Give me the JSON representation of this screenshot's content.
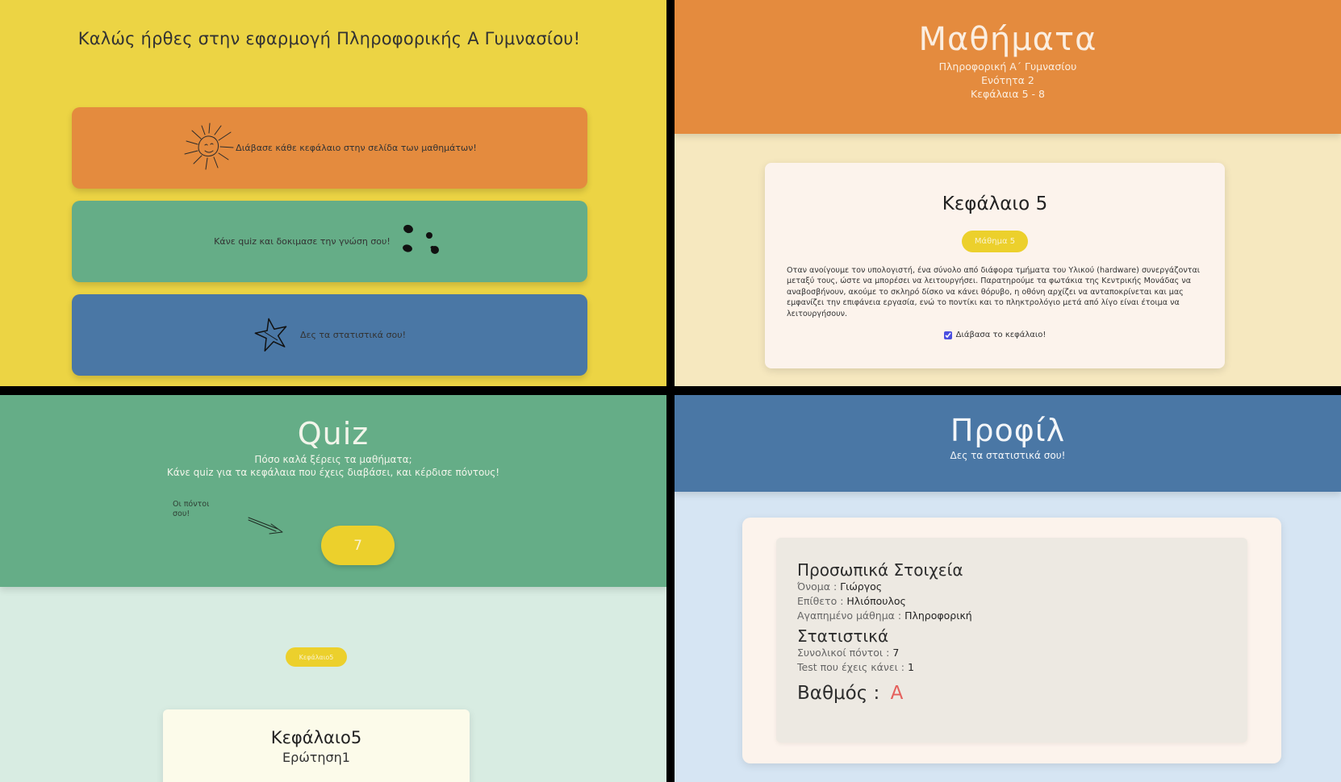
{
  "home": {
    "title": "Καλώς ήρθες στην εφαρμογή Πληροφορικής Α Γυμνασίου!",
    "cards": [
      {
        "label": "Διάβασε κάθε κεφάλαιο στην σελίδα των μαθημάτων!",
        "icon": "sun-doodle-icon",
        "color": "#e48b3e"
      },
      {
        "label": "Κάνε quiz και δοκιμασε την γνώση σου!",
        "icon": "dots-doodle-icon",
        "color": "#65ad87"
      },
      {
        "label": "Δες τα στατιστικά σου!",
        "icon": "star-doodle-icon",
        "color": "#4a77a5"
      }
    ]
  },
  "lessons": {
    "title": "Μαθήματα",
    "subtitle_lines": [
      "Πληροφορική Α΄ Γυμνασίου",
      "Ενότητα 2",
      "Κεφάλαια 5 - 8"
    ],
    "chapter": {
      "title": "Κεφάλαιο 5",
      "button_label": "Μάθημα 5",
      "text": "Οταν ανοίγουμε τον υπολογιστή, ένα σύνολο από διάφορα τμήματα του Υλικού (hardware) συνεργάζονται μεταξύ τους, ώστε να μπορέσει να λειτουργήσει. Παρατηρούμε τα φωτάκια της Κεντρικής Μονάδας να αναβοσβήνουν, ακούμε το σκληρό δίσκο να κάνει θόρυβο, η οθόνη αρχίζει να ανταποκρίνεται και μας εμφανίζει την επιφάνεια εργασία, ενώ το ποντίκι και το πληκτρολόγιο μετά από λίγο είναι έτοιμα να λειτουργήσουν.",
      "checkbox_label": "Διάβασα το κεφάλαιο!",
      "checked": true
    }
  },
  "quiz": {
    "title": "Quiz",
    "subtitle_lines": [
      "Πόσο καλά ξέρεις τα μαθήματα;",
      "Κάνε quiz για τα κεφάλαια που έχεις διαβάσει, και κέρδισε πόντους!"
    ],
    "points_label_lines": [
      "Οι πόντοι",
      "σου!"
    ],
    "points": "7",
    "chapter_button": "Κεφάλαιο5",
    "question_card": {
      "chapter": "Κεφάλαιο5",
      "question": "Ερώτηση1"
    }
  },
  "profile": {
    "title": "Προφίλ",
    "subtitle": "Δες τα στατιστικά σου!",
    "personal_title": "Προσωπικά Στοιχεία",
    "fields": [
      {
        "label": "Όνομα : ",
        "value": "Γιώργος"
      },
      {
        "label": "Επίθετο : ",
        "value": "Ηλιόπουλος"
      },
      {
        "label": "Αγαπημένο μάθημα : ",
        "value": "Πληροφορική"
      }
    ],
    "stats_title": "Στατιστικά",
    "stats": [
      {
        "label": "Συνολικοί πόντοι : ",
        "value": "7"
      },
      {
        "label": "Test που έχεις κάνει : ",
        "value": "1"
      }
    ],
    "grade_label": "Βαθμός : ",
    "grade_value": "Α",
    "grade_color": "#e5605c"
  },
  "colors": {
    "yellow": "#ecd444",
    "orange": "#e48b3e",
    "green": "#65ad87",
    "blue": "#4a77a5",
    "button_yellow": "#ecd02c"
  }
}
